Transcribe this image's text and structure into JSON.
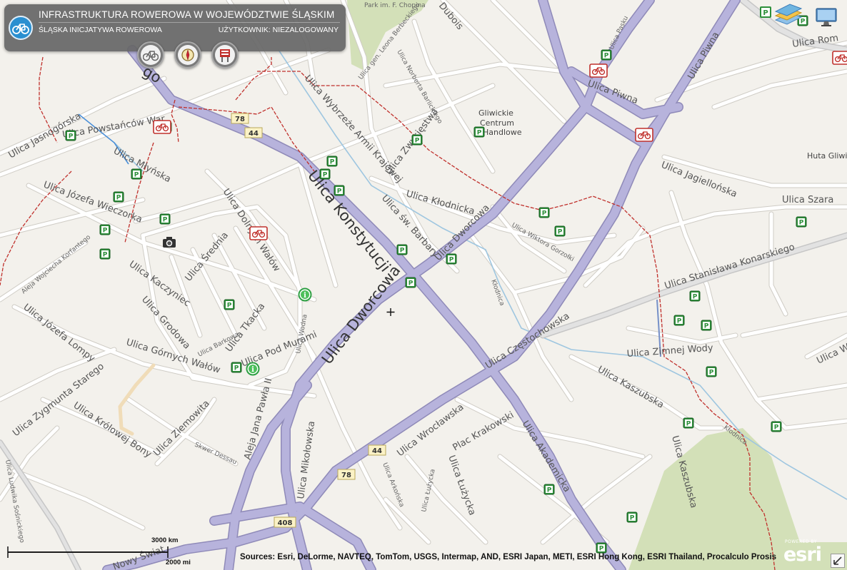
{
  "header": {
    "title": "INFRASTRUKTURA ROWEROWA W WOJEWÓDZTWIE ŚLĄSKIM",
    "subtitle": "ŚLĄSKA INICJATYWA ROWEROWA",
    "user_status": "UŻYTKOWNIK: NIEZALOGOWANY"
  },
  "toolbar": {
    "buttons": [
      {
        "icon": "bicycle-icon"
      },
      {
        "icon": "compass-icon"
      },
      {
        "icon": "info-board-icon"
      }
    ]
  },
  "top_right": {
    "icons": [
      "parking-icon",
      "layers-icon",
      "monitor-icon"
    ]
  },
  "streets": {
    "jasnogorska": "Ulica Jasnogórska",
    "powstancow": "Ulica Powstańców War",
    "mlynska": "Ulica Młyńska",
    "wieczorka": "Ulica Józefa Wieczorka",
    "korfantego": "Aleja Wojciecha Korfantego",
    "kaczyniec": "Ulica Kaczyniec",
    "grodowa": "Ulica Grodowa",
    "jozefa_lompy": "Ulica Józefa Lompy",
    "zygmunta": "Ulica Zygmunta Starego",
    "krolowej_bony": "Ulica Królowej Bony",
    "ziemowita": "Ulica Ziemowita",
    "ludwika": "Ulica Ludwika Sośnickiego",
    "skwer": "Skwer Dessau",
    "gornych_walow": "Ulica Górnych Wałów",
    "dolnych_walow": "Ulica Dolnych Wałów",
    "srednia": "Ulica Średnia",
    "tkacka": "Ulica Tkacka",
    "barlickiego": "Ulica Barkowa",
    "pod_murami": "Ulica Pod Murami",
    "wodna": "Ulica Wodna",
    "konstytucji": "Ulica Konstytucji",
    "dworcowa_big": "Ulica Dworcowa",
    "dworcowa": "Ulica Dworcowa",
    "wybrzeze": "Ulica Wybrzeże Armii Krajowej",
    "zwyciestwa": "Ulica Zwycięstwa",
    "klodnicka": "Ulica Kłodnicka",
    "sw_barbary": "Ulica św. Barbary",
    "jana_pawla": "Aleja Jana Pawła II",
    "mikolowska": "Ulica Mikołowska",
    "wroclawska": "Ulica Wrocławska",
    "czestochowska": "Ulica Częstochowska",
    "piwna": "Ulica Piwna",
    "piwna2": "Ulica Piwna",
    "jagiellonska": "Ulica Jagiellońska",
    "szara": "Ulica Szara",
    "konarskiego": "Ulica Stanisława Konarskiego",
    "zimnej_wody": "Ulica Zimnej Wody",
    "kaszubska": "Ulica Kaszubska",
    "kaszubska2": "Ulica Kaszubska",
    "akademicka": "Ulica Akademicka",
    "plac_krakowski": "Plac Krakowski",
    "luzycka": "Ulica Łużycka",
    "arkonska": "Ulica Arkońska",
    "luzycka_small": "Ulica Łużycka",
    "gorzolki": "Ulica Wiktora Gorzołki",
    "klodnica": "Kłodnica",
    "klodnica2": "Kłodnica",
    "barlickiego2": "Ulica Norberta Barlickiego",
    "berbeckiego": "Ulica gen. Leona Berbeckiego",
    "chopina_park": "Park im. F. Chopina",
    "dubois": "Dubois",
    "rom": "Ulica Rom",
    "pasku": "Ulica Pasku",
    "huta": "Huta Gliwice",
    "gliwickie": "Gliwickie",
    "centrum": "Centrum",
    "handlowe": "Handlowe",
    "nowy_swiat": "Nowy Świat",
    "go": "go",
    "ulica_w_right": "Ulica W"
  },
  "road_shields": {
    "s78a": "78",
    "s44a": "44",
    "s44b": "44",
    "s78b": "78",
    "s408": "408"
  },
  "scale": {
    "km": "3000 km",
    "mi": "2000 mi"
  },
  "attribution": "Sources: Esri, DeLorme, NAVTEQ, TomTom, USGS, Intermap, AND, ESRI Japan, METI, ESRI Hong Kong, ESRI Thailand, Procalculo Prosis",
  "esri": {
    "powered": "POWERED BY",
    "word": "esri"
  },
  "colors": {
    "background": "#f3f1ec",
    "major_road": "#b7b3dc",
    "street": "#ffffff",
    "street_casing": "#c9c6c0",
    "park": "#d3e0b8",
    "bike_route": "#c0302c",
    "parking_marker": "#2d8f3a",
    "info_marker": "#2ea043",
    "header_bg": "#666666"
  }
}
